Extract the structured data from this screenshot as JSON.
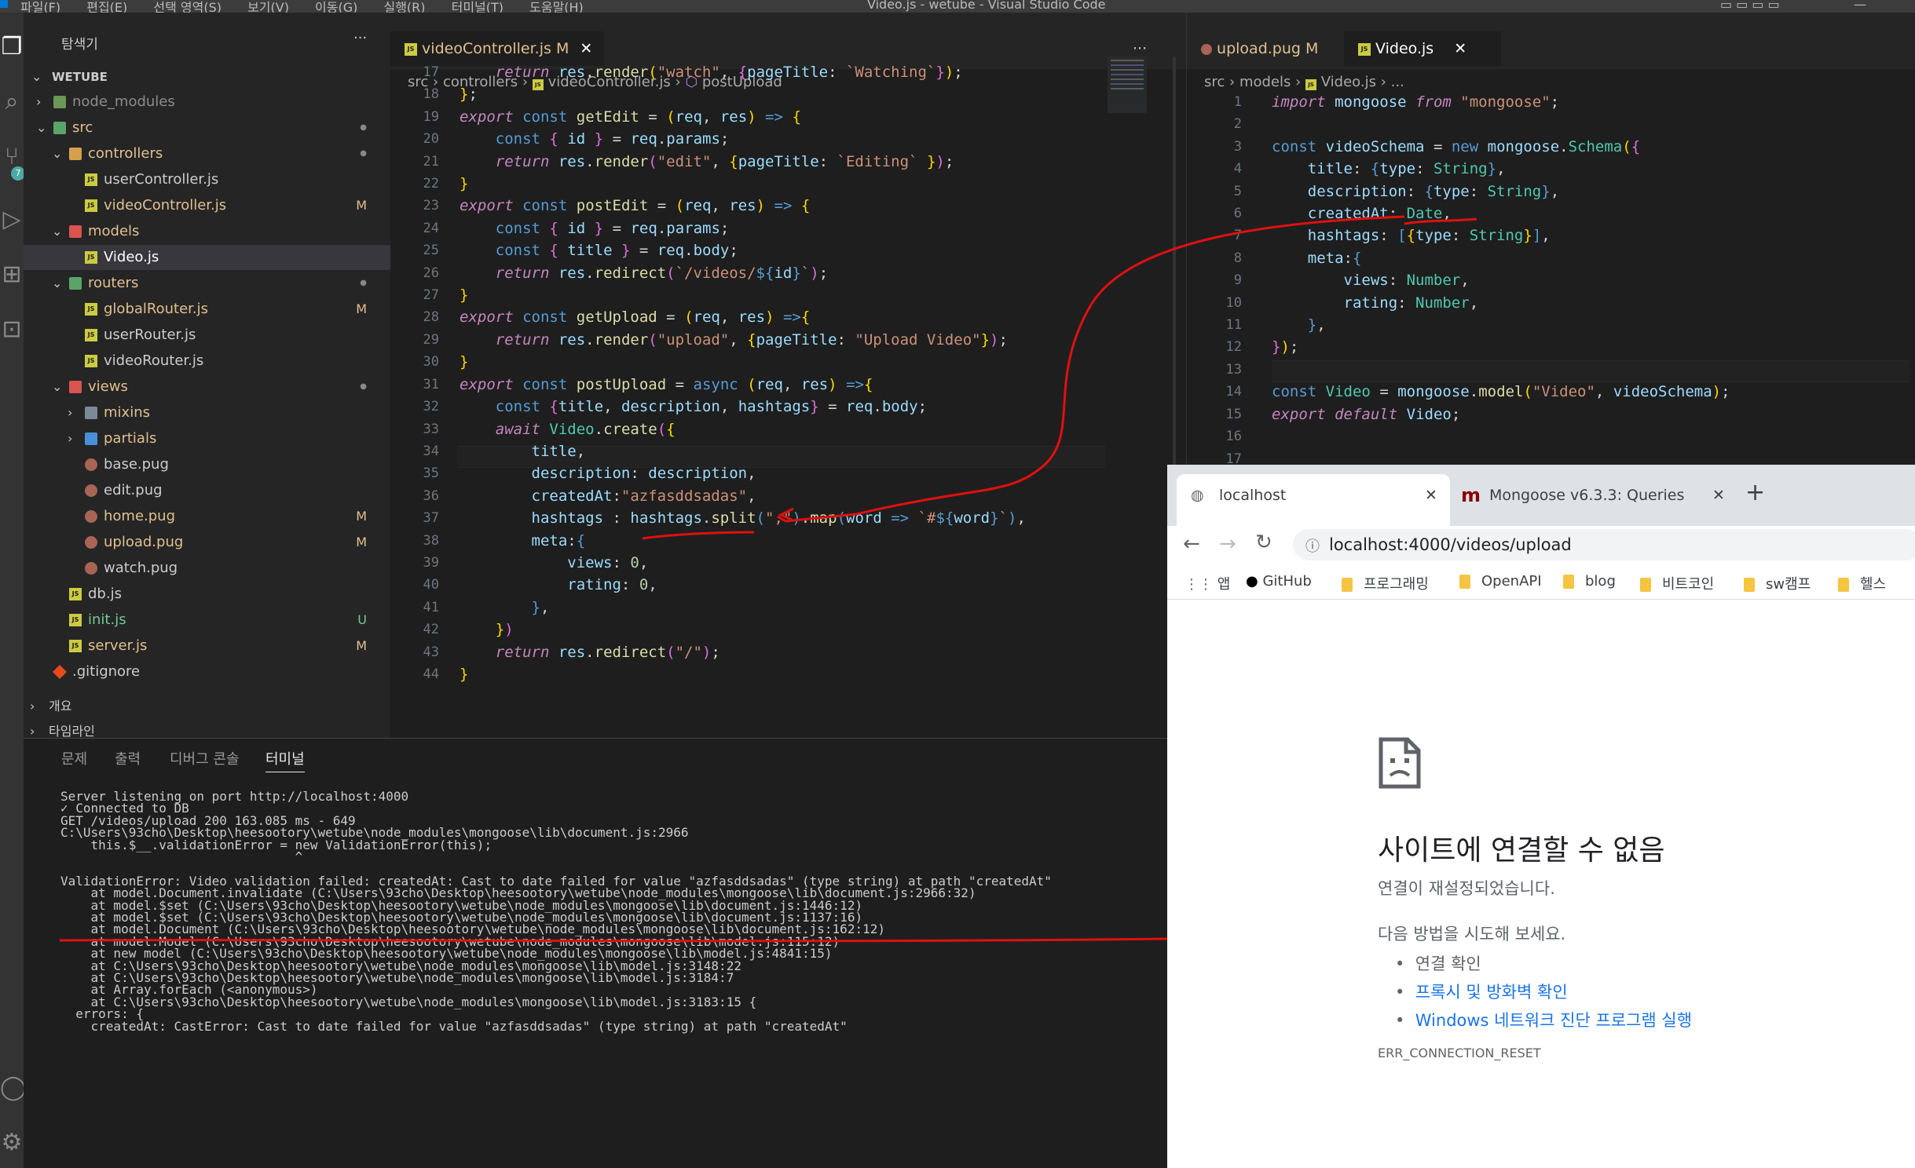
{
  "window": {
    "title": "Video.js - wetube - Visual Studio Code",
    "menu": [
      "파일(F)",
      "편집(E)",
      "선택 영역(S)",
      "보기(V)",
      "이동(G)",
      "실행(R)",
      "터미널(T)",
      "도움말(H)"
    ]
  },
  "activity": {
    "scm_badge": "7"
  },
  "explorer": {
    "title": "탐색기",
    "more": "···",
    "root": "WETUBE",
    "items": [
      {
        "label": "node_modules",
        "kind": "folder",
        "status": ""
      },
      {
        "label": "src",
        "kind": "folder",
        "status": "●"
      },
      {
        "label": "controllers",
        "kind": "folder",
        "status": "●"
      },
      {
        "label": "userController.js",
        "kind": "js",
        "status": ""
      },
      {
        "label": "videoController.js",
        "kind": "js",
        "status": "M"
      },
      {
        "label": "models",
        "kind": "folder",
        "status": ""
      },
      {
        "label": "Video.js",
        "kind": "js",
        "status": ""
      },
      {
        "label": "routers",
        "kind": "folder",
        "status": "●"
      },
      {
        "label": "globalRouter.js",
        "kind": "js",
        "status": "M"
      },
      {
        "label": "userRouter.js",
        "kind": "js",
        "status": ""
      },
      {
        "label": "videoRouter.js",
        "kind": "js",
        "status": ""
      },
      {
        "label": "views",
        "kind": "folder",
        "status": "●"
      },
      {
        "label": "mixins",
        "kind": "folder",
        "status": ""
      },
      {
        "label": "partials",
        "kind": "folder",
        "status": ""
      },
      {
        "label": "base.pug",
        "kind": "pug",
        "status": ""
      },
      {
        "label": "edit.pug",
        "kind": "pug",
        "status": ""
      },
      {
        "label": "home.pug",
        "kind": "pug",
        "status": "M"
      },
      {
        "label": "upload.pug",
        "kind": "pug",
        "status": "M"
      },
      {
        "label": "watch.pug",
        "kind": "pug",
        "status": ""
      },
      {
        "label": "db.js",
        "kind": "js",
        "status": ""
      },
      {
        "label": "init.js",
        "kind": "js",
        "status": "U"
      },
      {
        "label": "server.js",
        "kind": "js",
        "status": "M"
      },
      {
        "label": ".gitignore",
        "kind": "git",
        "status": ""
      }
    ],
    "outline": "개요",
    "timeline": "타임라인"
  },
  "editor_left": {
    "tab": "videoController.js",
    "tab_status": "M",
    "close": "✕",
    "more": "···",
    "breadcrumb": [
      "src",
      "controllers",
      "videoController.js",
      "postUpload"
    ],
    "line_numbers": [
      "17",
      "18",
      "19",
      "20",
      "21",
      "22",
      "23",
      "24",
      "25",
      "26",
      "27",
      "28",
      "29",
      "30",
      "31",
      "32",
      "33",
      "34",
      "35",
      "36",
      "37",
      "38",
      "39",
      "40",
      "41",
      "42",
      "43",
      "44"
    ]
  },
  "editor_right": {
    "tab_inactive": "upload.pug",
    "tab_inactive_status": "M",
    "tab_active": "Video.js",
    "close": "✕",
    "breadcrumb": [
      "src",
      "models",
      "Video.js",
      "..."
    ],
    "line_numbers": [
      "1",
      "2",
      "3",
      "4",
      "5",
      "6",
      "7",
      "8",
      "9",
      "10",
      "11",
      "12",
      "13",
      "14",
      "15",
      "16",
      "17"
    ]
  },
  "terminal": {
    "tabs": [
      "문제",
      "출력",
      "디버그 콘솔",
      "터미널"
    ],
    "active_tab": "터미널",
    "lines": [
      "Server listening on port http://localhost:4000",
      "✓ Connected to DB",
      "GET /videos/upload 200 163.085 ms - 649",
      "C:\\Users\\93cho\\Desktop\\heesootory\\wetube\\node_modules\\mongoose\\lib\\document.js:2966",
      "    this.$__.validationError = new ValidationError(this);",
      "                               ^",
      "",
      "ValidationError: Video validation failed: createdAt: Cast to date failed for value \"azfasddsadas\" (type string) at path \"createdAt\"",
      "    at model.Document.invalidate (C:\\Users\\93cho\\Desktop\\heesootory\\wetube\\node_modules\\mongoose\\lib\\document.js:2966:32)",
      "    at model.$set (C:\\Users\\93cho\\Desktop\\heesootory\\wetube\\node_modules\\mongoose\\lib\\document.js:1446:12)",
      "    at model.$set (C:\\Users\\93cho\\Desktop\\heesootory\\wetube\\node_modules\\mongoose\\lib\\document.js:1137:16)",
      "    at model.Document (C:\\Users\\93cho\\Desktop\\heesootory\\wetube\\node_modules\\mongoose\\lib\\document.js:162:12)",
      "    at model.Model (C:\\Users\\93cho\\Desktop\\heesootory\\wetube\\node_modules\\mongoose\\lib\\model.js:115:12)",
      "    at new model (C:\\Users\\93cho\\Desktop\\heesootory\\wetube\\node_modules\\mongoose\\lib\\model.js:4841:15)",
      "    at C:\\Users\\93cho\\Desktop\\heesootory\\wetube\\node_modules\\mongoose\\lib\\model.js:3148:22",
      "    at C:\\Users\\93cho\\Desktop\\heesootory\\wetube\\node_modules\\mongoose\\lib\\model.js:3184:7",
      "    at Array.forEach (<anonymous>)",
      "    at C:\\Users\\93cho\\Desktop\\heesootory\\wetube\\node_modules\\mongoose\\lib\\model.js:3183:15 {",
      "  errors: {",
      "    createdAt: CastError: Cast to date failed for value \"azfasddsadas\" (type string) at path \"createdAt\""
    ]
  },
  "browser": {
    "tabs": [
      {
        "title": "localhost",
        "active": true
      },
      {
        "title": "Mongoose v6.3.3: Queries",
        "active": false
      }
    ],
    "new_tab": "+",
    "url": "localhost:4000/videos/upload",
    "bookmarks": [
      "앱",
      "GitHub",
      "프로그래밍",
      "OpenAPI",
      "blog",
      "비트코인",
      "sw캠프",
      "헬스"
    ],
    "error": {
      "title": "사이트에 연결할 수 없음",
      "subtitle": "연결이 재설정되었습니다.",
      "try_heading": "다음 방법을 시도해 보세요.",
      "suggestions": [
        "연결 확인",
        "프록시 및 방화벽 확인",
        "Windows 네트워크 진단 프로그램 실행"
      ],
      "code": "ERR_CONNECTION_RESET"
    }
  }
}
